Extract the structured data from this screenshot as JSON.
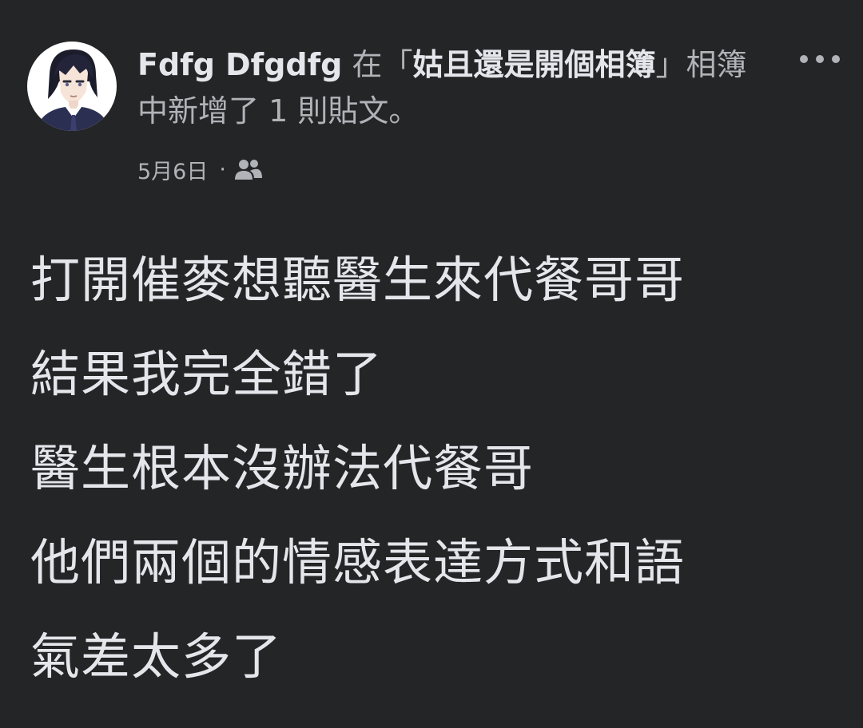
{
  "post": {
    "author": "Fdfg Dfgdfg",
    "action_prefix": " 在",
    "album_open": "「",
    "album_name": "姑且還是開個相簿",
    "album_close": "」",
    "action_suffix": "相簿中新增了 1 則貼文。",
    "date": "5月6日",
    "separator": "·",
    "privacy_icon": "friends-icon",
    "more_icon": "more-horizontal-icon",
    "body_lines": [
      "打開催麥想聽醫生來代餐哥哥",
      "結果我完全錯了",
      "醫生根本沒辦法代餐哥",
      "他們兩個的情感表達方式和語",
      "氣差太多了"
    ]
  },
  "colors": {
    "background": "#242526",
    "primary_text": "#e4e6eb",
    "secondary_text": "#b0b3b8"
  }
}
